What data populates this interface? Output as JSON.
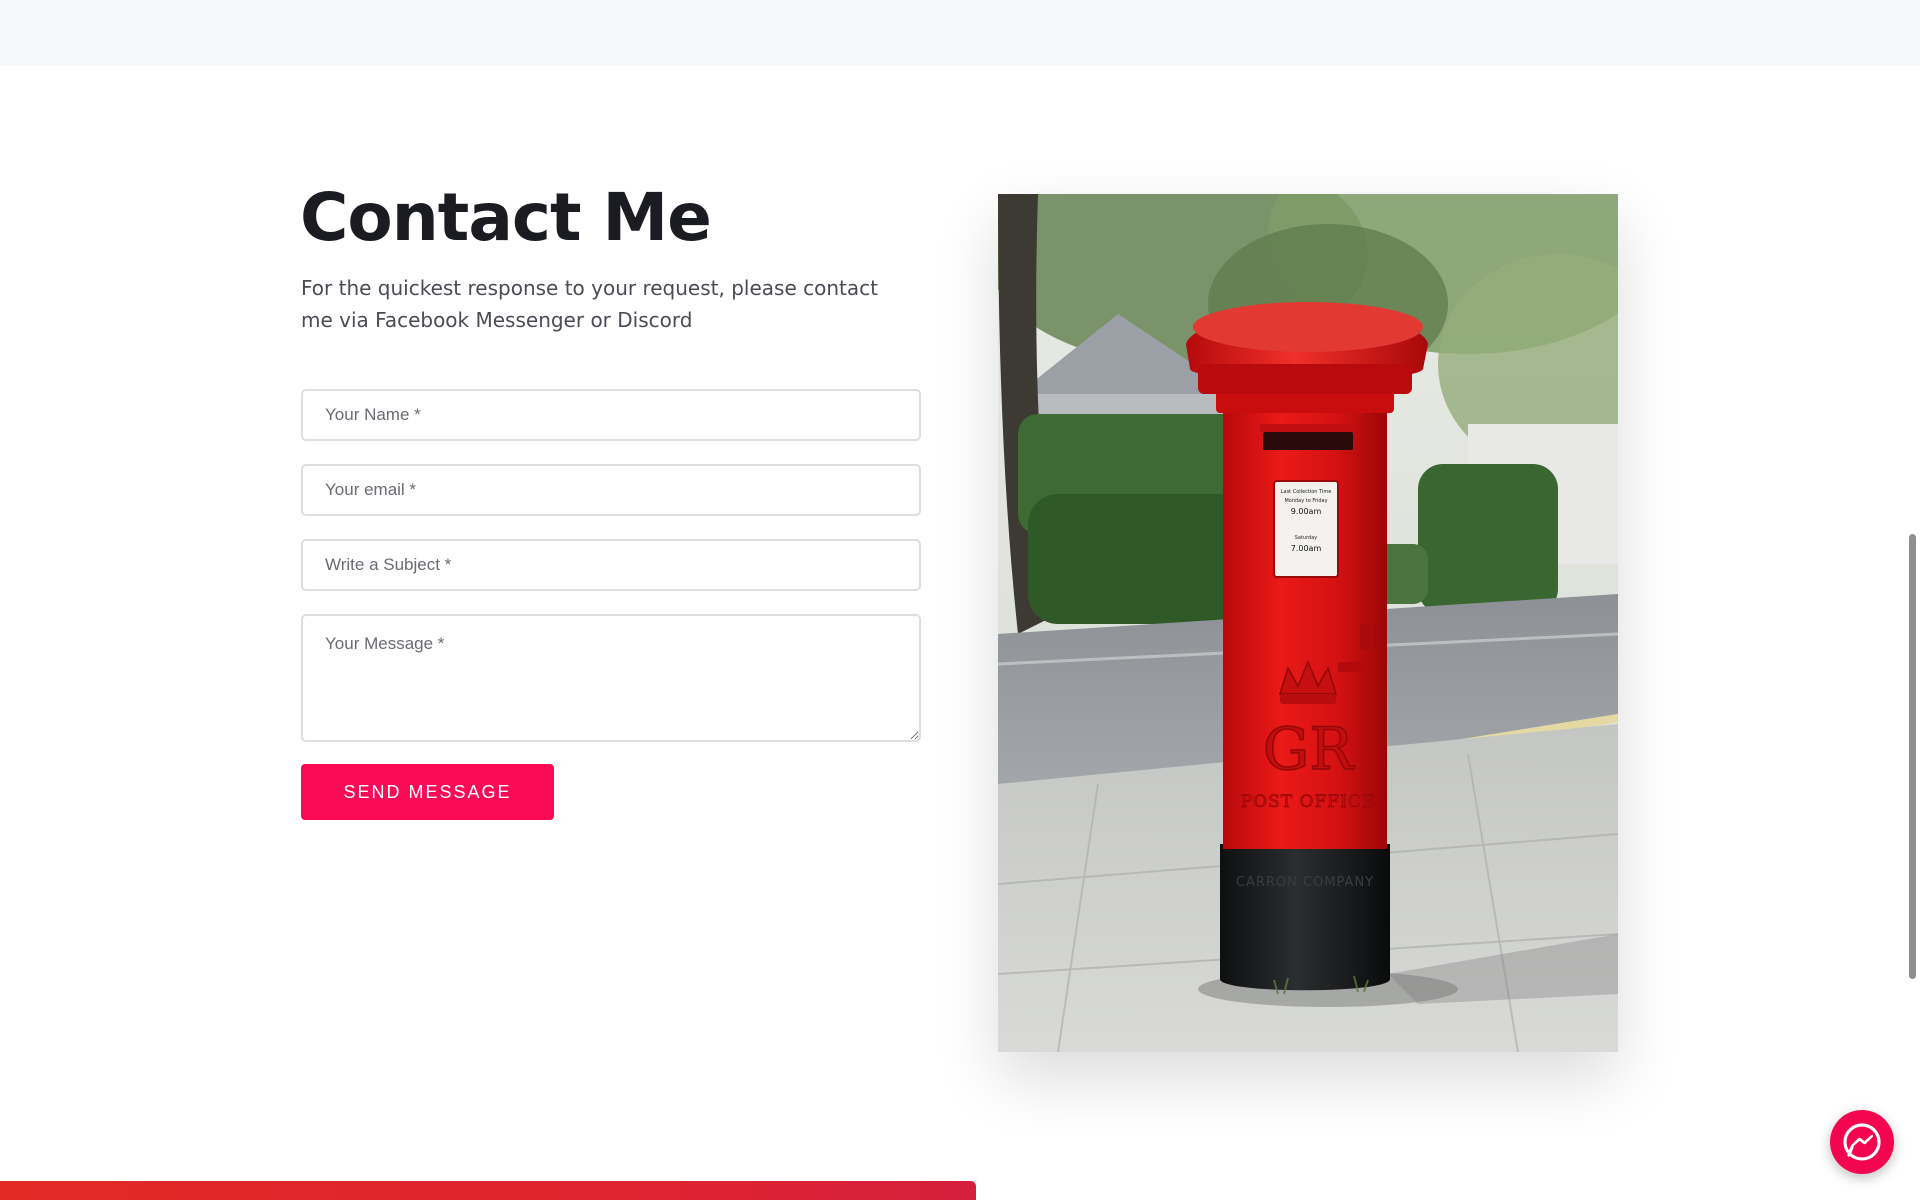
{
  "contact": {
    "title": "Contact Me",
    "description": "For the quickest response to your request, please contact me via Facebook Messenger or Discord",
    "fields": {
      "name_placeholder": "Your Name *",
      "email_placeholder": "Your email *",
      "subject_placeholder": "Write a Subject *",
      "message_placeholder": "Your Message *"
    },
    "send_label": "SEND MESSAGE"
  },
  "photo": {
    "subject": "red post box",
    "embossed_letters": "GR",
    "embossed_text": "POST OFFICE",
    "base_text": "CARRON COMPANY",
    "notice": {
      "heading": "Last Collection Time",
      "weekday_label": "Monday to Friday",
      "weekday_time": "9.00am",
      "saturday_label": "Saturday",
      "saturday_time": "7.00am"
    }
  },
  "widgets": {
    "messenger_icon": "messenger-icon"
  },
  "colors": {
    "accent": "#fb0a55",
    "messenger": "#f3064f",
    "heading": "#1b1b22",
    "bottom_bar": "#e12a24"
  }
}
